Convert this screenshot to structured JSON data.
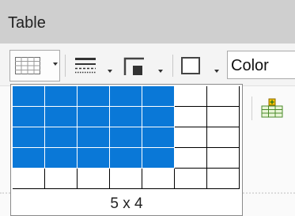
{
  "window": {
    "title": "Table"
  },
  "toolbar": {
    "items": [
      {
        "name": "insert-table",
        "icon": "table-grid-icon"
      },
      {
        "name": "borders",
        "icon": "line-style-icon"
      },
      {
        "name": "border-color",
        "icon": "border-color-icon"
      },
      {
        "name": "border-style",
        "icon": "border-box-icon"
      }
    ],
    "color_label": "Color",
    "insert_rows_icon": "insert-rows-icon"
  },
  "table_picker": {
    "columns": 7,
    "rows": 5,
    "selected_columns": 5,
    "selected_rows": 4,
    "size_label": "5 x 4"
  },
  "colors": {
    "selection": "#0a78d7",
    "titlebar": "#cfcfcf",
    "toolbar": "#f4f4f4"
  }
}
